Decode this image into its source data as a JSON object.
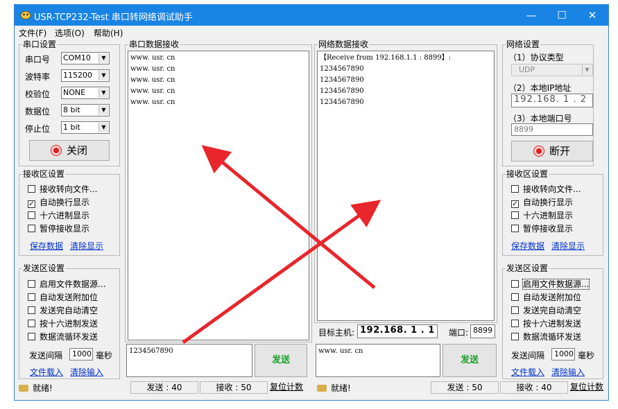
{
  "window": {
    "title": "USR-TCP232-Test 串口转网络调试助手",
    "minimize": "—",
    "maximize": "☐",
    "close": "✕"
  },
  "menu": [
    "文件(F)",
    "选项(O)",
    "帮助(H)"
  ],
  "serial_settings": {
    "title": "串口设置",
    "port_label": "串口号",
    "port_value": "COM10",
    "baud_label": "波特率",
    "baud_value": "115200",
    "parity_label": "校验位",
    "parity_value": "NONE",
    "data_label": "数据位",
    "data_value": "8 bit",
    "stop_label": "停止位",
    "stop_value": "1 bit",
    "toggle_label": "关闭"
  },
  "left_recv_settings": {
    "title": "接收区设置",
    "options": [
      {
        "label": "接收转向文件...",
        "checked": false
      },
      {
        "label": "自动换行显示",
        "checked": true
      },
      {
        "label": "十六进制显示",
        "checked": false
      },
      {
        "label": "暂停接收显示",
        "checked": false
      }
    ],
    "save_link": "保存数据",
    "clear_link": "清除显示"
  },
  "left_send_settings": {
    "title": "发送区设置",
    "options": [
      {
        "label": "启用文件数据源...",
        "checked": false
      },
      {
        "label": "自动发送附加位",
        "checked": false
      },
      {
        "label": "发送完自动清空",
        "checked": false
      },
      {
        "label": "按十六进制发送",
        "checked": false
      },
      {
        "label": "数据流循环发送",
        "checked": false
      }
    ],
    "interval_label": "发送间隔",
    "interval_value": "1000",
    "interval_unit": "毫秒",
    "load_link": "文件载入",
    "clear_link": "清除输入"
  },
  "serial_receive": {
    "title": "串口数据接收",
    "lines": [
      "www. usr. cn",
      "www. usr. cn",
      "www. usr. cn",
      "www. usr. cn",
      "www. usr. cn"
    ]
  },
  "serial_send": {
    "text": "1234567890",
    "send_label": "发送"
  },
  "net_receive": {
    "title": "网络数据接收",
    "lines": [
      "【Receive from 192.168.1.1 : 8899】:",
      "1234567890",
      "1234567890",
      "1234567890",
      "1234567890"
    ]
  },
  "target": {
    "host_label": "目标主机:",
    "host_value": "192.168. 1 . 1",
    "port_label": "端口:",
    "port_value": "8899"
  },
  "net_send": {
    "text": "www. usr. cn",
    "send_label": "发送"
  },
  "net_settings": {
    "title": "网络设置",
    "protocol_label": "（1）协议类型",
    "protocol_value": "UDP",
    "ip_label": "（2）本地IP地址",
    "ip_value": "192.168. 1 . 2",
    "port_label": "（3）本地端口号",
    "port_value": "8899",
    "toggle_label": "断开"
  },
  "right_recv_settings": {
    "title": "接收区设置",
    "options": [
      {
        "label": "接收转向文件...",
        "checked": false
      },
      {
        "label": "自动换行显示",
        "checked": true
      },
      {
        "label": "十六进制显示",
        "checked": false
      },
      {
        "label": "暂停接收显示",
        "checked": false
      }
    ],
    "save_link": "保存数据",
    "clear_link": "清除显示"
  },
  "right_send_settings": {
    "title": "发送区设置",
    "options": [
      {
        "label": "启用文件数据源...",
        "checked": false
      },
      {
        "label": "自动发送附加位",
        "checked": false
      },
      {
        "label": "发送完自动清空",
        "checked": false
      },
      {
        "label": "按十六进制发送",
        "checked": false
      },
      {
        "label": "数据流循环发送",
        "checked": false
      }
    ],
    "interval_label": "发送间隔",
    "interval_value": "1000",
    "interval_unit": "毫秒",
    "load_link": "文件载入",
    "clear_link": "清除输入"
  },
  "status_left": {
    "ready": "就绪!",
    "sent": "发送 : 40",
    "received": "接收 : 50",
    "reset": "复位计数"
  },
  "status_right": {
    "ready": "就绪!",
    "sent": "发送 : 50",
    "received": "接收 : 40",
    "reset": "复位计数"
  },
  "colors": {
    "titlebar": "#1a84e4",
    "arrow": "#e8262b",
    "send_text": "#1a9e2a",
    "link": "#0033cc"
  }
}
